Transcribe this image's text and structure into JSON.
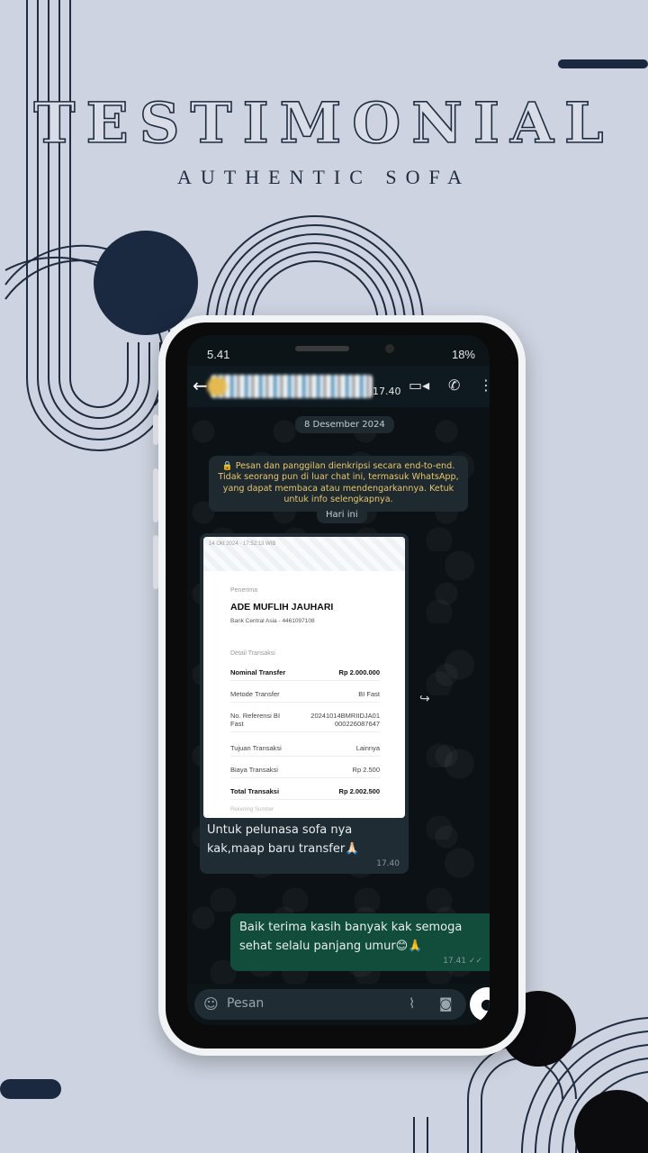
{
  "colors": {
    "background": "#cdd3e0",
    "navy": "#1f2c3f",
    "wa_dark": "#0b1115",
    "bubble_in": "#1f2c33",
    "bubble_out": "#124d3c",
    "enc_text": "#e9c66c"
  },
  "poster": {
    "title": "TESTIMONIAL",
    "subtitle": "AUTHENTIC SOFA"
  },
  "status_bar": {
    "time": "5.41",
    "battery": "18%"
  },
  "header": {
    "time": "17.40",
    "icons": [
      "back-arrow-icon",
      "video-call-icon",
      "phone-icon",
      "more-vert-icon"
    ]
  },
  "chat": {
    "date_pill": "8 Desember 2024",
    "encryption_notice": "🔒 Pesan dan panggilan dienkripsi secara end-to-end. Tidak seorang pun di luar chat ini, termasuk WhatsApp, yang dapat membaca atau mendengarkannya. Ketuk untuk info selengkapnya.",
    "today_pill": "Hari ini",
    "incoming": {
      "receipt": {
        "stamp": "14 Okt 2024 · 17:52:13 WIB",
        "recipient_label": "Penerima",
        "recipient_name": "ADE MUFLIH JAUHARI",
        "bank": "Bank Central Asia - 4461097108",
        "section_label": "Detail Transaksi",
        "rows": [
          {
            "k": "Nominal Transfer",
            "v": "Rp 2.000.000",
            "bold": true
          },
          {
            "k": "Metode Transfer",
            "v": "BI Fast",
            "bold": false
          },
          {
            "k": "No. Referensi BI Fast",
            "v": "20241014BMRIIDJA01 000226087647",
            "bold": false
          },
          {
            "k": "Tujuan Transaksi",
            "v": "Lainnya",
            "bold": false
          },
          {
            "k": "Biaya Transaksi",
            "v": "Rp 2.500",
            "bold": false
          },
          {
            "k": "Total Transaksi",
            "v": "Rp 2.002.500",
            "bold": true
          }
        ],
        "footer_faded": "Rekening Sumber"
      },
      "caption": "Untuk pelunasa sofa nya kak,maap baru transfer🙏🏻",
      "time": "17.40"
    },
    "outgoing": {
      "text": "Baik terima kasih banyak kak semoga sehat selalu panjang umur😊🙏",
      "time": "17.41",
      "ticks": "✓✓"
    }
  },
  "composer": {
    "placeholder": "Pesan"
  }
}
